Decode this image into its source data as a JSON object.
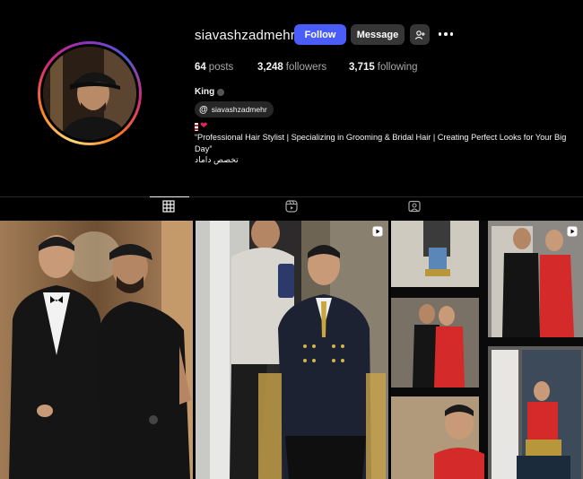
{
  "profile": {
    "username": "siavashzadmehr",
    "follow_label": "Follow",
    "message_label": "Message",
    "posts_count": "64",
    "posts_label": "posts",
    "followers_count": "3,248",
    "followers_label": "followers",
    "following_count": "3,715",
    "following_label": "following",
    "full_name": "King",
    "threads_handle": "siavashzadmehr",
    "bio_line": "“Professional Hair Stylist | Specializing in Grooming & Bridal Hair | Creating Perfect Looks for Your Big Day”",
    "bio_persian": "تخصص داماد"
  },
  "icons": {
    "add_user": "add-user-icon",
    "more": "more-options-icon",
    "posts_tab": "grid-icon",
    "reels_tab": "reels-icon",
    "tagged_tab": "tagged-icon"
  },
  "colors": {
    "follow_button": "#4a5df9",
    "secondary_button": "#363636",
    "background": "#000000"
  },
  "grid": {
    "tiles": [
      {
        "label": "",
        "overlay": ""
      },
      {
        "label": "",
        "overlay": ""
      },
      {
        "label": "",
        "overlay": ""
      },
      {
        "label": "",
        "overlay": "REC"
      }
    ]
  }
}
